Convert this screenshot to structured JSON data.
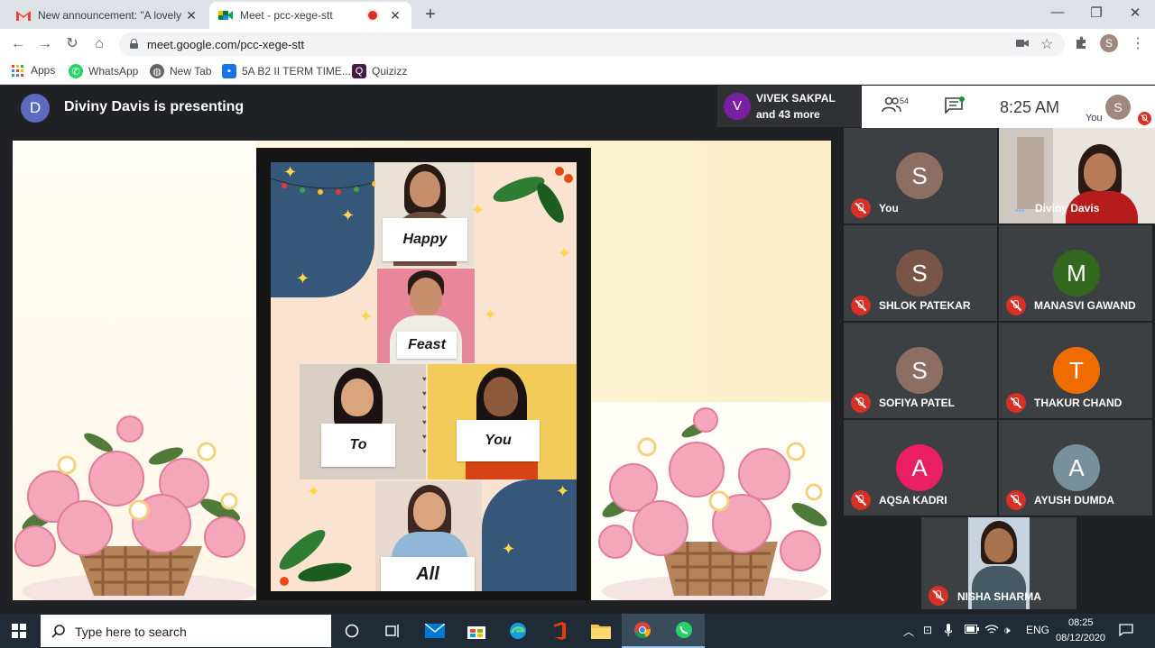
{
  "browser": {
    "tabs": [
      {
        "title": "New announcement: \"A lovely m",
        "active": false
      },
      {
        "title": "Meet - pcc-xege-stt",
        "active": true
      }
    ],
    "url": "meet.google.com/pcc-xege-stt",
    "profile_initial": "S",
    "bookmarks": [
      "Apps",
      "WhatsApp",
      "New Tab",
      "5A B2 II TERM TIME...",
      "Quizizz"
    ]
  },
  "meet": {
    "presenter_initial": "D",
    "presenting_text": "Diviny Davis is presenting",
    "viewer_initial": "V",
    "viewer_name": "VIVEK SAKPAL",
    "viewer_more": "and 43 more",
    "participant_count": "54",
    "time": "8:25 AM",
    "you_label": "You",
    "you_initial": "S"
  },
  "slide": {
    "words": [
      "Happy",
      "Feast",
      "To",
      "You",
      "All"
    ]
  },
  "participants": [
    {
      "name": "You",
      "initial": "S",
      "color": "#8d6e63",
      "video": false
    },
    {
      "name": "Diviny Davis",
      "initial": "",
      "color": "",
      "video": true
    },
    {
      "name": "SHLOK PATEKAR",
      "initial": "S",
      "color": "#795548",
      "video": false
    },
    {
      "name": "MANASVI GAWAND",
      "initial": "M",
      "color": "#33691e",
      "video": false
    },
    {
      "name": "SOFIYA PATEL",
      "initial": "S",
      "color": "#8d6e63",
      "video": false
    },
    {
      "name": "THAKUR CHAND",
      "initial": "T",
      "color": "#ef6c00",
      "video": false
    },
    {
      "name": "AQSA KADRI",
      "initial": "A",
      "color": "#e91e63",
      "video": false
    },
    {
      "name": "AYUSH DUMDA",
      "initial": "A",
      "color": "#78909c",
      "video": false
    },
    {
      "name": "NISHA SHARMA",
      "initial": "",
      "color": "",
      "video": true
    }
  ],
  "taskbar": {
    "search_placeholder": "Type here to search",
    "language": "ENG",
    "time": "08:25",
    "date": "08/12/2020"
  },
  "colors": {
    "meet_bg": "#202124",
    "tile_bg": "#3c4043",
    "mic_off": "#d93025",
    "taskbar": "#1f2b36"
  }
}
